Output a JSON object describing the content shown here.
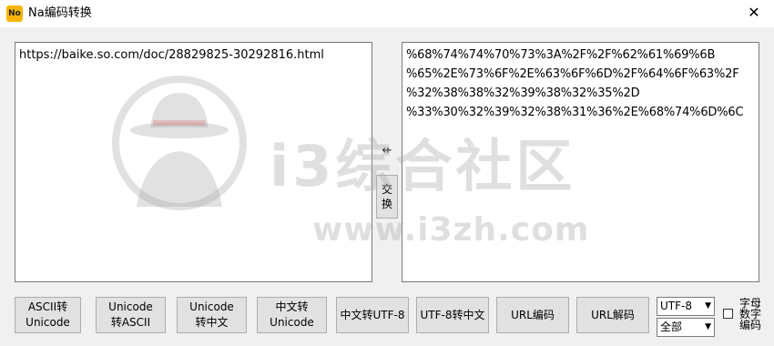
{
  "window": {
    "title": "Na编码转换",
    "icon_text": "No",
    "close_symbol": "✕"
  },
  "input": {
    "text": "https://baike.so.com/doc/28829825-30292816.html"
  },
  "output": {
    "lines": [
      "%68%74%74%70%73%3A%2F%2F%62%61%69%6B",
      "%65%2E%73%6F%2E%63%6F%6D%2F%64%6F%63%2F",
      "%32%38%38%32%39%38%32%35%2D",
      "%33%30%32%39%32%38%31%36%2E%68%74%6D%6C"
    ]
  },
  "swap": {
    "arrow": "⇷",
    "label_line1": "交",
    "label_line2": "换"
  },
  "buttons": [
    {
      "line1": "ASCII转",
      "line2": "Unicode"
    },
    {
      "line1": "Unicode",
      "line2": "转ASCII"
    },
    {
      "line1": "Unicode",
      "line2": "转中文"
    },
    {
      "line1": "中文转",
      "line2": "Unicode"
    },
    {
      "line1": "中文转UTF-8",
      "line2": ""
    },
    {
      "line1": "UTF-8转中文",
      "line2": ""
    },
    {
      "line1": "URL编码",
      "line2": ""
    },
    {
      "line1": "URL解码",
      "line2": ""
    }
  ],
  "encoding_select": {
    "value": "UTF-8"
  },
  "scope_select": {
    "value": "全部"
  },
  "alnum_checkbox": {
    "checked": false,
    "label_line1": "字母",
    "label_line2": "数字",
    "label_line3": "编码"
  },
  "watermark": {
    "cn": "i3综合社区",
    "url": "www.i3zh.com"
  },
  "colors": {
    "window_bg": "#f0f0f0",
    "button_bg": "#e1e1e1",
    "icon_bg": "#f7b500"
  }
}
